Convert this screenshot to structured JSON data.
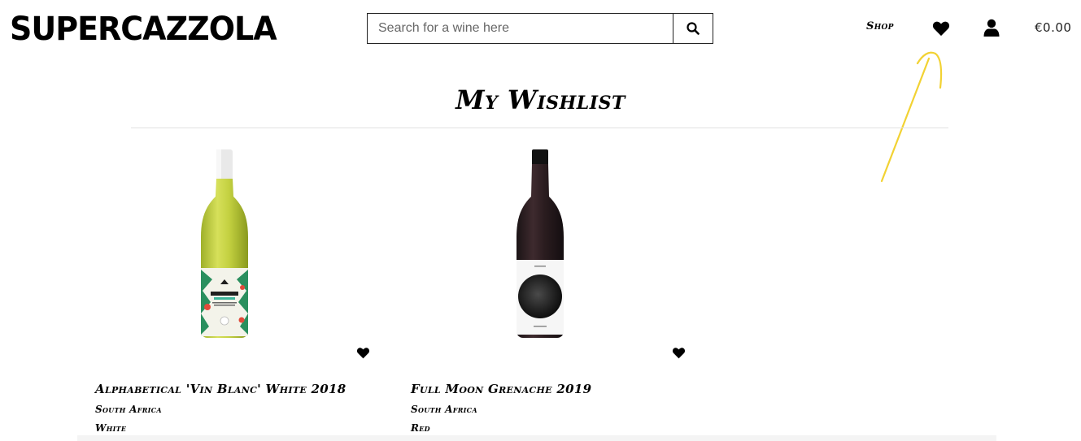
{
  "header": {
    "logo": "SUPERCAZZOLA",
    "search": {
      "placeholder": "Search for a wine here",
      "button_icon": "search-icon"
    },
    "nav": {
      "shop_label": "Shop",
      "wishlist_icon": "heart-icon",
      "account_icon": "user-icon",
      "cart_total": "€0.00"
    }
  },
  "main": {
    "title": "My Wishlist",
    "products": [
      {
        "name": "Alphabetical 'Vin Blanc' White 2018",
        "country": "South Africa",
        "type": "White",
        "image_label": "ALPHABETICAL",
        "wishlist_icon": "heart-icon"
      },
      {
        "name": "Full Moon Grenache 2019",
        "country": "South Africa",
        "type": "Red",
        "wishlist_icon": "heart-icon"
      }
    ]
  },
  "colors": {
    "annotation_arrow": "#f2d233",
    "text": "#000000",
    "divider": "#e2e2e2"
  }
}
